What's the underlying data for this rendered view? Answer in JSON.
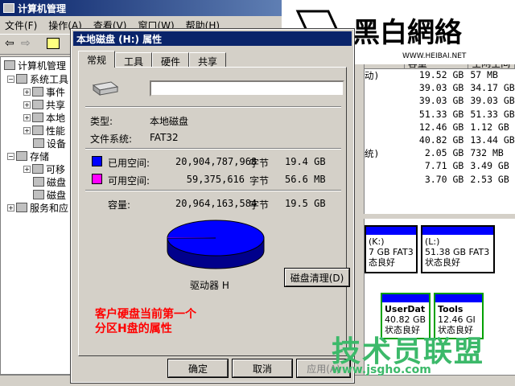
{
  "main_window": {
    "title": "计算机管理",
    "menu": [
      "文件(F)",
      "操作(A)",
      "查看(V)",
      "窗口(W)",
      "帮助(H)"
    ],
    "tree": [
      {
        "label": "计算机管理",
        "icon": "computer-icon"
      },
      {
        "label": "系统工具",
        "icon": "tools-icon"
      },
      {
        "label": "事件",
        "icon": "event-icon"
      },
      {
        "label": "共享",
        "icon": "share-icon"
      },
      {
        "label": "本地",
        "icon": "users-icon"
      },
      {
        "label": "性能",
        "icon": "perf-icon"
      },
      {
        "label": "设备",
        "icon": "device-icon"
      },
      {
        "label": "存储",
        "icon": "storage-icon"
      },
      {
        "label": "可移",
        "icon": "removable-icon"
      },
      {
        "label": "磁盘",
        "icon": "defrag-icon"
      },
      {
        "label": "磁盘",
        "icon": "disk-icon"
      },
      {
        "label": "服务和应",
        "icon": "services-icon"
      }
    ],
    "list_headers": [
      "",
      "容量",
      "空闲空间"
    ],
    "list_rows": [
      {
        "status": "动)",
        "capacity": "19.52 GB",
        "free": "57 MB"
      },
      {
        "status": "",
        "capacity": "39.03 GB",
        "free": "34.17 GB"
      },
      {
        "status": "",
        "capacity": "39.03 GB",
        "free": "39.03 GB"
      },
      {
        "status": "",
        "capacity": "51.33 GB",
        "free": "51.33 GB"
      },
      {
        "status": "",
        "capacity": "12.46 GB",
        "free": "1.12 GB"
      },
      {
        "status": "",
        "capacity": "40.82 GB",
        "free": "13.44 GB"
      },
      {
        "status": "统)",
        "capacity": "2.05 GB",
        "free": "732 MB"
      },
      {
        "status": "",
        "capacity": "7.71 GB",
        "free": "3.49 GB"
      },
      {
        "status": "",
        "capacity": "3.70 GB",
        "free": "2.53 GB"
      }
    ],
    "volumes": [
      {
        "name": "(K:)",
        "size": "7 GB FAT3",
        "state": "态良好"
      },
      {
        "name": "(L:)",
        "size": "51.38 GB FAT3",
        "state": "状态良好"
      },
      {
        "name": "UserDat",
        "size": "40.82 GB",
        "state": "状态良好"
      },
      {
        "name": "Tools",
        "size": "12.46 GI",
        "state": "状态良好"
      }
    ]
  },
  "dialog": {
    "title": "本地磁盘 (H:) 属性",
    "tabs": [
      "常规",
      "工具",
      "硬件",
      "共享"
    ],
    "name_value": "",
    "type_label": "类型:",
    "type_value": "本地磁盘",
    "fs_label": "文件系统:",
    "fs_value": "FAT32",
    "used_label": "已用空间:",
    "used_bytes": "20,904,787,968",
    "used_unit": "字节",
    "used_size": "19.4 GB",
    "free_label": "可用空间:",
    "free_bytes": "59,375,616",
    "free_unit": "字节",
    "free_size": "56.6 MB",
    "cap_label": "容量:",
    "cap_bytes": "20,964,163,584",
    "cap_unit": "字节",
    "cap_size": "19.5 GB",
    "drive_label": "驱动器 H",
    "cleanup_button": "磁盘清理(D)",
    "annotation_line1": "客户硬盘当前第一个",
    "annotation_line2": "分区H盘的属性",
    "ok": "确定",
    "cancel": "取消",
    "apply": "应用(A)",
    "used_fraction": 0.997,
    "colors": {
      "used": "#0000ff",
      "free": "#ff00ff"
    }
  },
  "watermarks": {
    "logo_text": "黑白網絡",
    "logo_url": "WWW.HEIBAI.NET",
    "site_text": "技术员联盟",
    "site_url": "www.jsgho.com"
  }
}
